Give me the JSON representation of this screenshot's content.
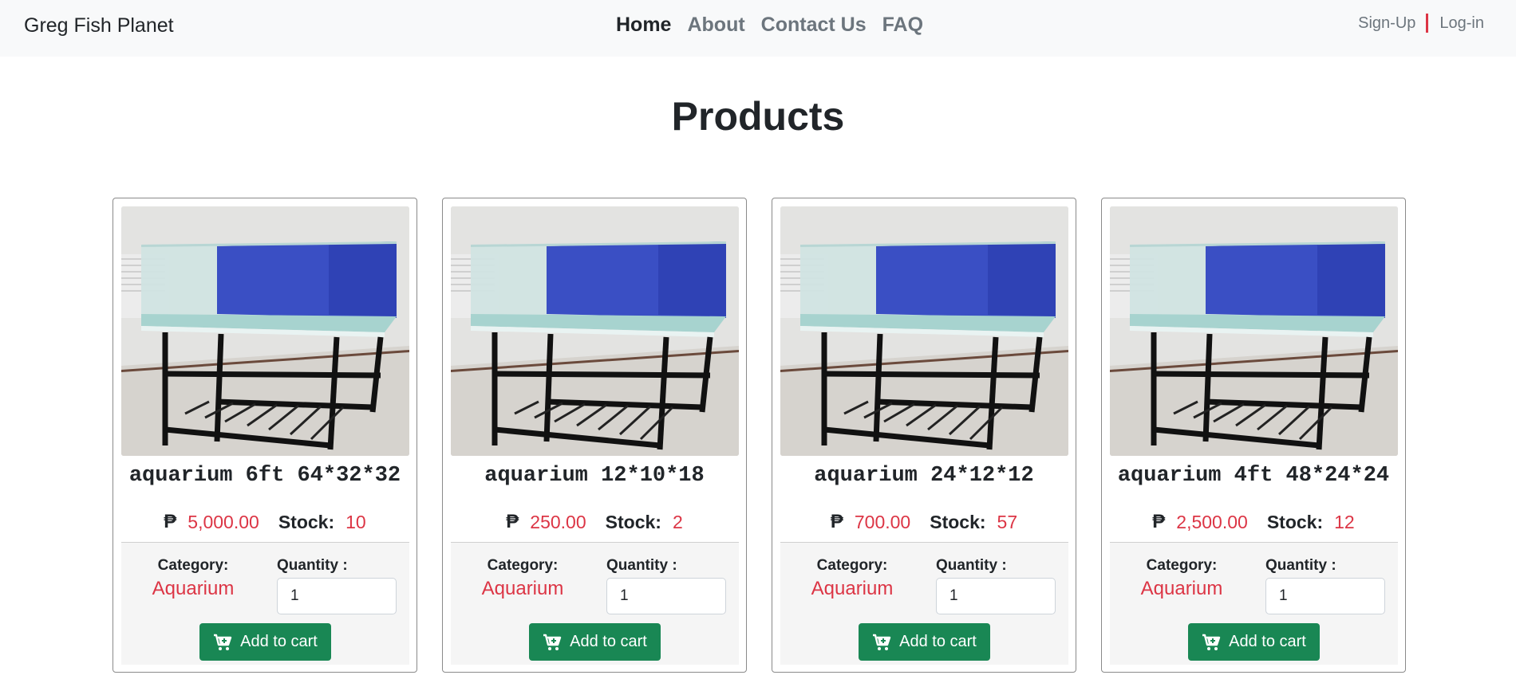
{
  "navbar": {
    "brand": "Greg Fish Planet",
    "links": [
      "Home",
      "About",
      "Contact Us",
      "FAQ"
    ],
    "signup": "Sign-Up",
    "login": "Log-in"
  },
  "page": {
    "title": "Products"
  },
  "labels": {
    "currency": "₱",
    "stock": "Stock:",
    "category": "Category:",
    "quantity": "Quantity :",
    "add_to_cart": "Add to cart"
  },
  "products": [
    {
      "name": "aquarium 6ft 64*32*32",
      "price": "5,000.00",
      "stock": "10",
      "category": "Aquarium",
      "quantity": "1"
    },
    {
      "name": "aquarium 12*10*18",
      "price": "250.00",
      "stock": "2",
      "category": "Aquarium",
      "quantity": "1"
    },
    {
      "name": "aquarium 24*12*12",
      "price": "700.00",
      "stock": "57",
      "category": "Aquarium",
      "quantity": "1"
    },
    {
      "name": "aquarium 4ft 48*24*24",
      "price": "2,500.00",
      "stock": "12",
      "category": "Aquarium",
      "quantity": "1"
    }
  ],
  "colors": {
    "accent_red": "#dc3545",
    "button_green": "#198754",
    "navbar_bg": "#f8f9fa"
  },
  "icons": {
    "cart": "cart-plus-icon"
  }
}
